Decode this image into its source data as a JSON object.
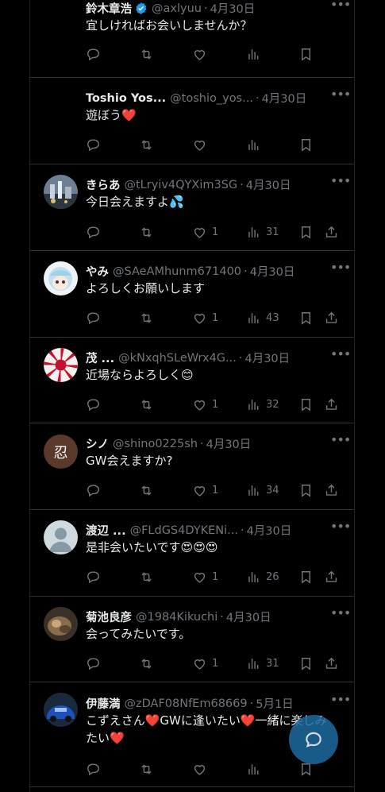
{
  "colors": {
    "background": "#000000",
    "text": "#e7e9ea",
    "muted": "#71767b",
    "heart": "#f91880",
    "accent": "#1d9bf0"
  },
  "tweets": [
    {
      "name": "鈴木章浩",
      "handle": "@axlyuu",
      "dot": "·",
      "date": "4月30日",
      "verified": true,
      "text": "宜しければお会いしませんか？",
      "likes": "",
      "views": "",
      "share": false,
      "avatar": "none"
    },
    {
      "name": "Toshio Yos...",
      "handle": "@toshio_yos...",
      "dot": "·",
      "date": "4月30日",
      "verified": false,
      "text": "遊ぼう❤️",
      "likes": "",
      "views": "",
      "share": false,
      "avatar": "none"
    },
    {
      "name": "きらあ",
      "handle": "@tLryiv4QYXim3SG",
      "dot": "·",
      "date": "4月30日",
      "verified": false,
      "text": "今日会えますよ💦",
      "likes": "1",
      "views": "31",
      "share": true,
      "avatar": "photo-city"
    },
    {
      "name": "やみ",
      "handle": "@SAeAMhunm671400",
      "dot": "·",
      "date": "4月30日",
      "verified": false,
      "text": "よろしくお願いします",
      "likes": "1",
      "views": "43",
      "share": true,
      "avatar": "anime-girl"
    },
    {
      "name": "茂 ...",
      "handle": "@kNxqhSLeWrx4G...",
      "dot": "·",
      "date": "4月30日",
      "verified": false,
      "text": "近場ならよろしく😊",
      "likes": "1",
      "views": "32",
      "share": true,
      "avatar": "rising-sun-flag"
    },
    {
      "name": "シノ",
      "handle": "@shino0225sh",
      "dot": "·",
      "date": "4月30日",
      "verified": false,
      "text": "GW会えますか?",
      "likes": "1",
      "views": "34",
      "share": true,
      "avatar": "kanji-shinobu",
      "avatar_char": "忍"
    },
    {
      "name": "渡辺 ...",
      "handle": "@FLdGS4DYKENi...",
      "dot": "·",
      "date": "4月30日",
      "verified": false,
      "text": "是非会いたいです😍😍😍",
      "likes": "1",
      "views": "26",
      "share": true,
      "avatar": "default-profile"
    },
    {
      "name": "菊池良彦",
      "handle": "@1984Kikuchi",
      "dot": "·",
      "date": "4月30日",
      "verified": false,
      "text": "会ってみたいです。",
      "likes": "1",
      "views": "31",
      "share": true,
      "avatar": "photo-cat"
    },
    {
      "name": "伊藤満",
      "handle": "@zDAF08NfEm68669",
      "dot": "·",
      "date": "5月1日",
      "verified": false,
      "text": "こずえさん❤️GWに逢いたい❤️一緒に楽しみたい❤️",
      "likes": "",
      "views": "",
      "share": false,
      "avatar": "photo-car"
    }
  ],
  "more_glyph": "•••"
}
